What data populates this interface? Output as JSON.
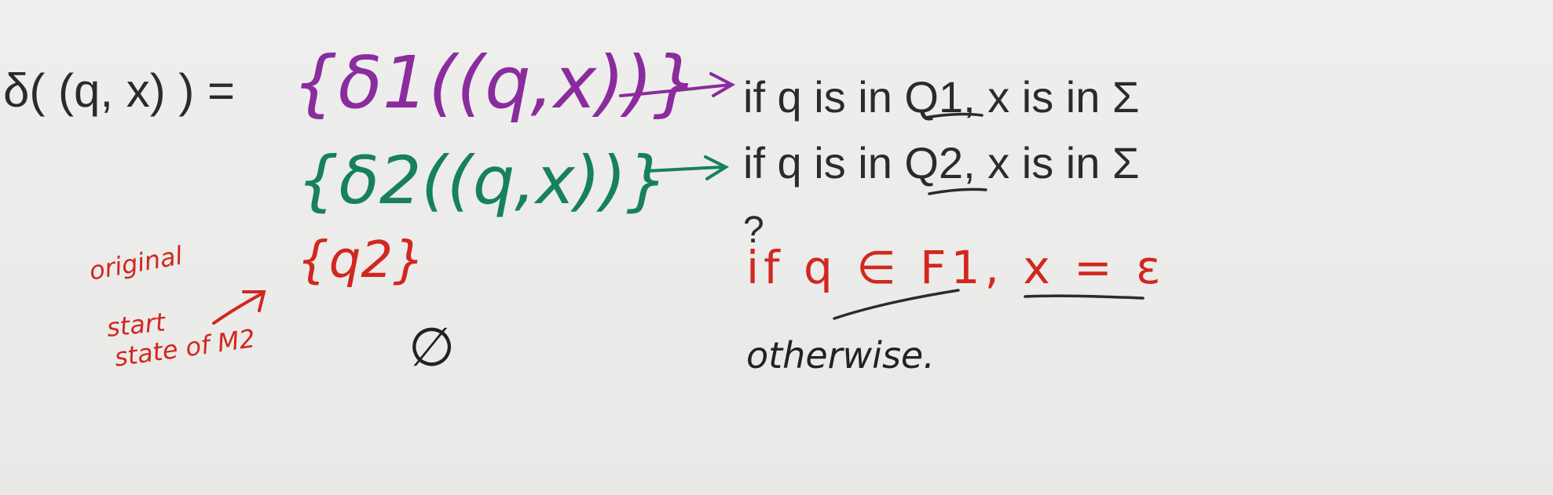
{
  "lhs": "δ( (q, x) ) =",
  "cases": [
    {
      "expr": "{δ1((q,x))}",
      "condition": "if q is in Q1, x is in Σ"
    },
    {
      "expr": "{δ2((q,x))}",
      "condition": "if q is in Q2, x is in Σ"
    },
    {
      "expr": "{q2}",
      "condition": "if q ∈ F1, x = ε"
    },
    {
      "expr": "∅",
      "condition": "otherwise."
    }
  ],
  "question_mark": "?",
  "note": {
    "line1": "original",
    "line2": "start",
    "line3": "state of M2"
  },
  "colors": {
    "typed": "#2b2b2b",
    "purple": "#8a2c9e",
    "green": "#17805f",
    "red": "#d1271f",
    "ink": "#222222"
  }
}
